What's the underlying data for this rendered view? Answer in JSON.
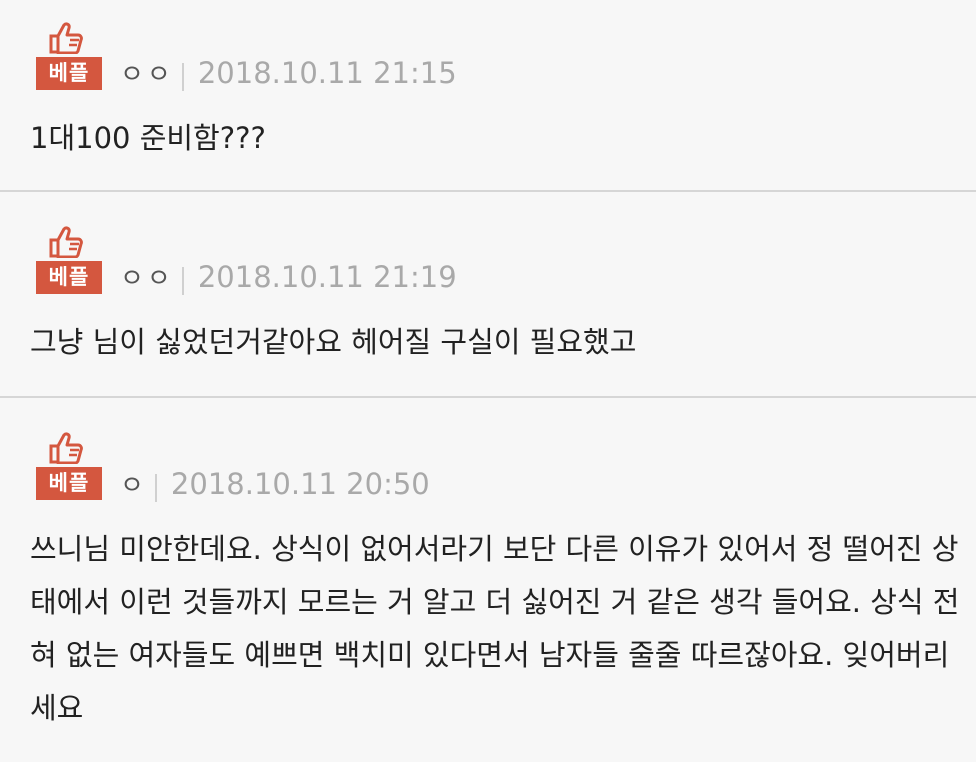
{
  "comments": [
    {
      "badge": "베플",
      "author": "ㅇㅇ",
      "date": "2018.10.11 21:15",
      "text": "1대100 준비함???"
    },
    {
      "badge": "베플",
      "author": "ㅇㅇ",
      "date": "2018.10.11 21:19",
      "text": "그냥 님이 싫었던거같아요 헤어질 구실이 필요했고"
    },
    {
      "badge": "베플",
      "author": "ㅇ",
      "date": "2018.10.11 20:50",
      "text": "쓰니님 미안한데요. 상식이 없어서라기 보단 다른 이유가 있어서 정 떨어진 상태에서 이런 것들까지 모르는 거 알고 더 싫어진 거 같은 생각 들어요. 상식 전혀 없는 여자들도 예쁘면 백치미 있다면서 남자들 줄줄 따르잖아요. 잊어버리세요"
    }
  ],
  "icons": {
    "best": "thumbs-up-icon"
  },
  "colors": {
    "badge": "#d4573f",
    "date": "#a9a9a9",
    "text": "#222222",
    "background": "#f7f7f7"
  }
}
